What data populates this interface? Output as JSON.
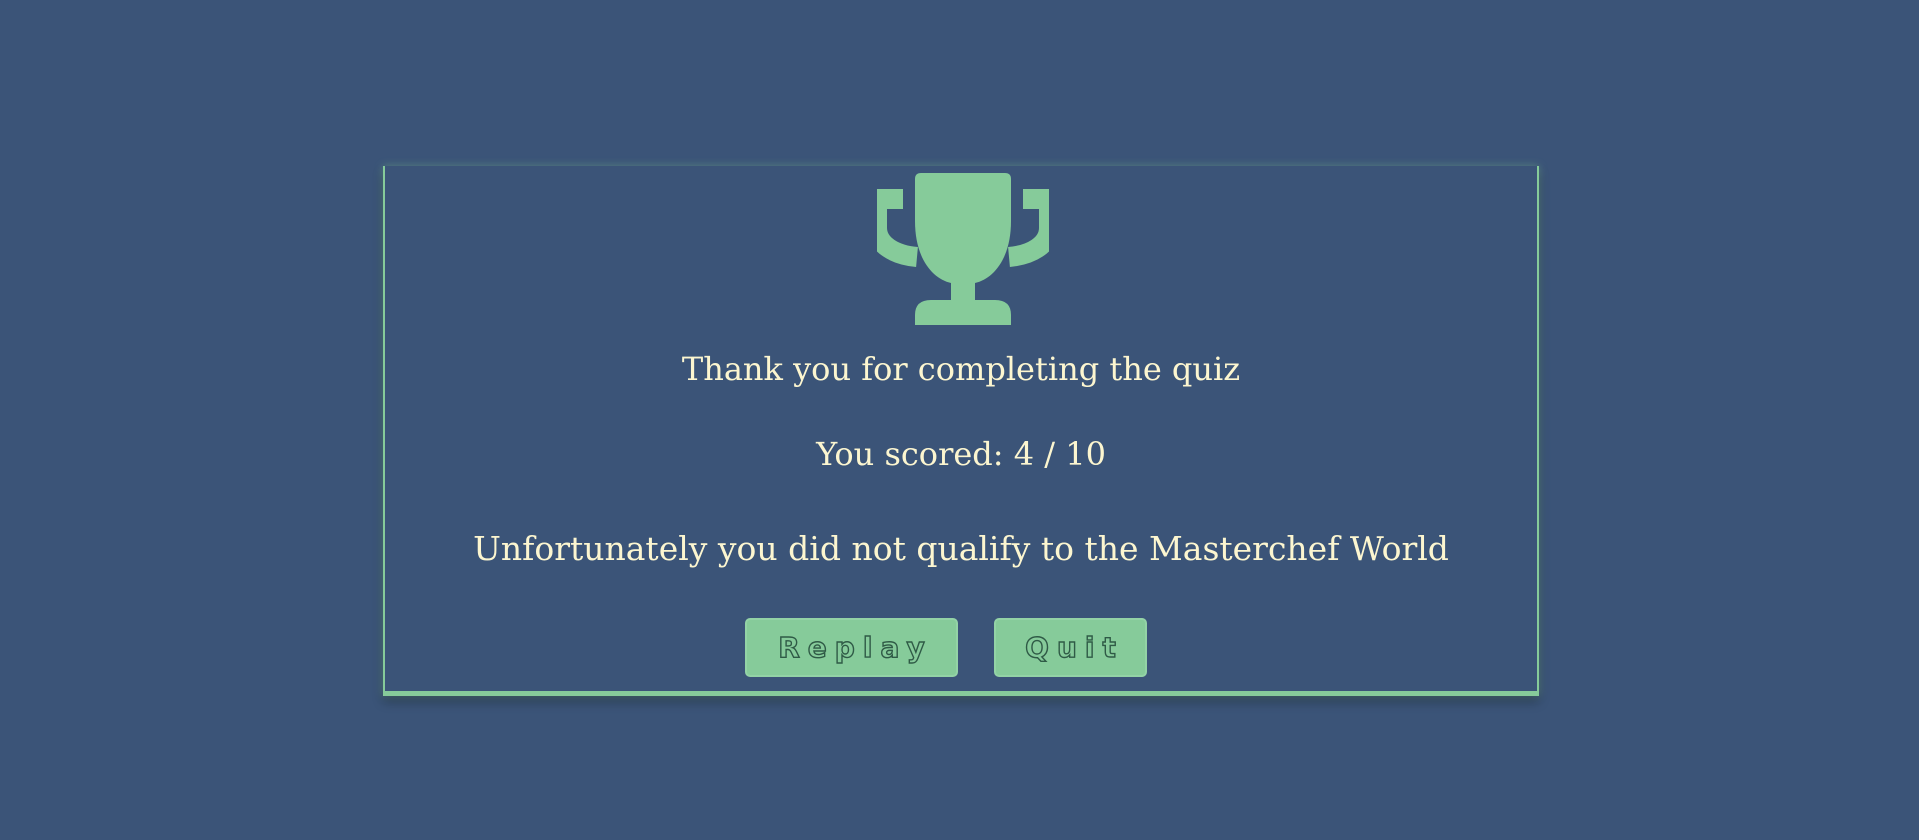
{
  "colors": {
    "background": "#3b5478",
    "accent": "#86cb9a",
    "text": "#fcf6d0"
  },
  "icon": "trophy-icon",
  "result": {
    "thanks_text": "Thank you for completing the quiz",
    "score_text": "You scored: 4 / 10",
    "outcome_text": "Unfortunately you did not qualify to the Masterchef World"
  },
  "actions": {
    "replay_label": "Replay",
    "quit_label": "Quit"
  }
}
